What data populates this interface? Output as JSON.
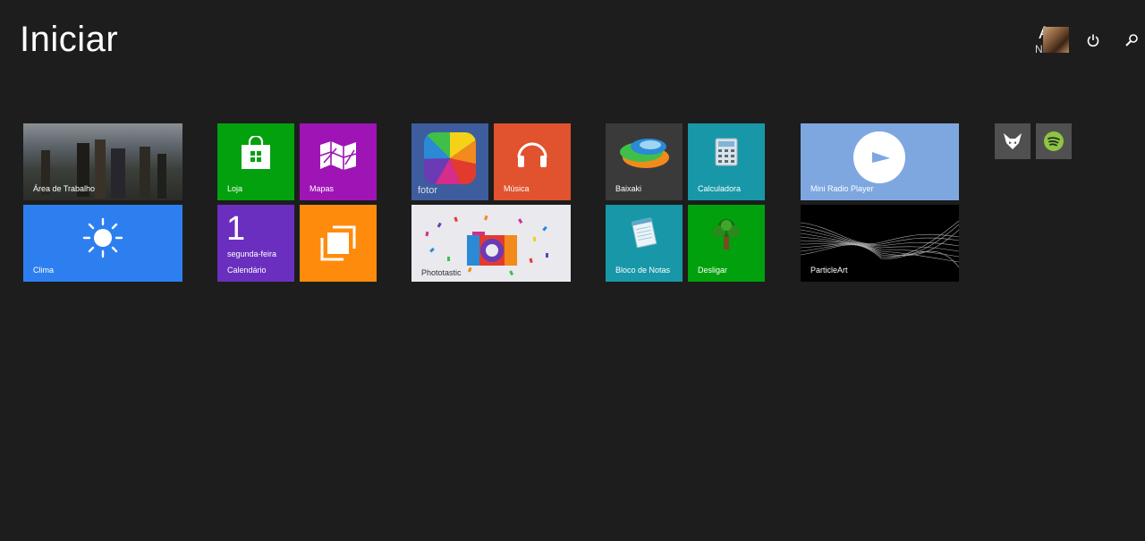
{
  "header": {
    "title": "Iniciar",
    "user_first": "Ana",
    "user_last": "Nemes",
    "power_icon": "power-icon",
    "search_icon": "search-icon"
  },
  "tiles": {
    "desktop": "Área de Trabalho",
    "weather": "Clima",
    "store": "Loja",
    "maps": "Mapas",
    "calendar_day": "1",
    "calendar_weekday": "segunda-feira",
    "calendar": "Calendário",
    "fotor": "fotor",
    "music": "Música",
    "phototastic": "Phototastic",
    "baixaki": "Baixaki",
    "calculator": "Calculadora",
    "notepad": "Bloco de Notas",
    "shutdown": "Desligar",
    "radio": "Mini Radio Player",
    "particle": "ParticleArt"
  },
  "colors": {
    "background": "#1d1d1d",
    "weather": "#2d7ff0",
    "store": "#03a10e",
    "maps": "#9e14b5",
    "calendar": "#6b2fbf",
    "orange": "#ff8b0c",
    "fotor": "#3e5d9e",
    "music": "#e0532e",
    "baixaki": "#3a3a3a",
    "teal": "#1897a8",
    "shutdown": "#01a00d",
    "radio": "#7ea7e0",
    "small1": "#505050",
    "small2": "#505050"
  }
}
